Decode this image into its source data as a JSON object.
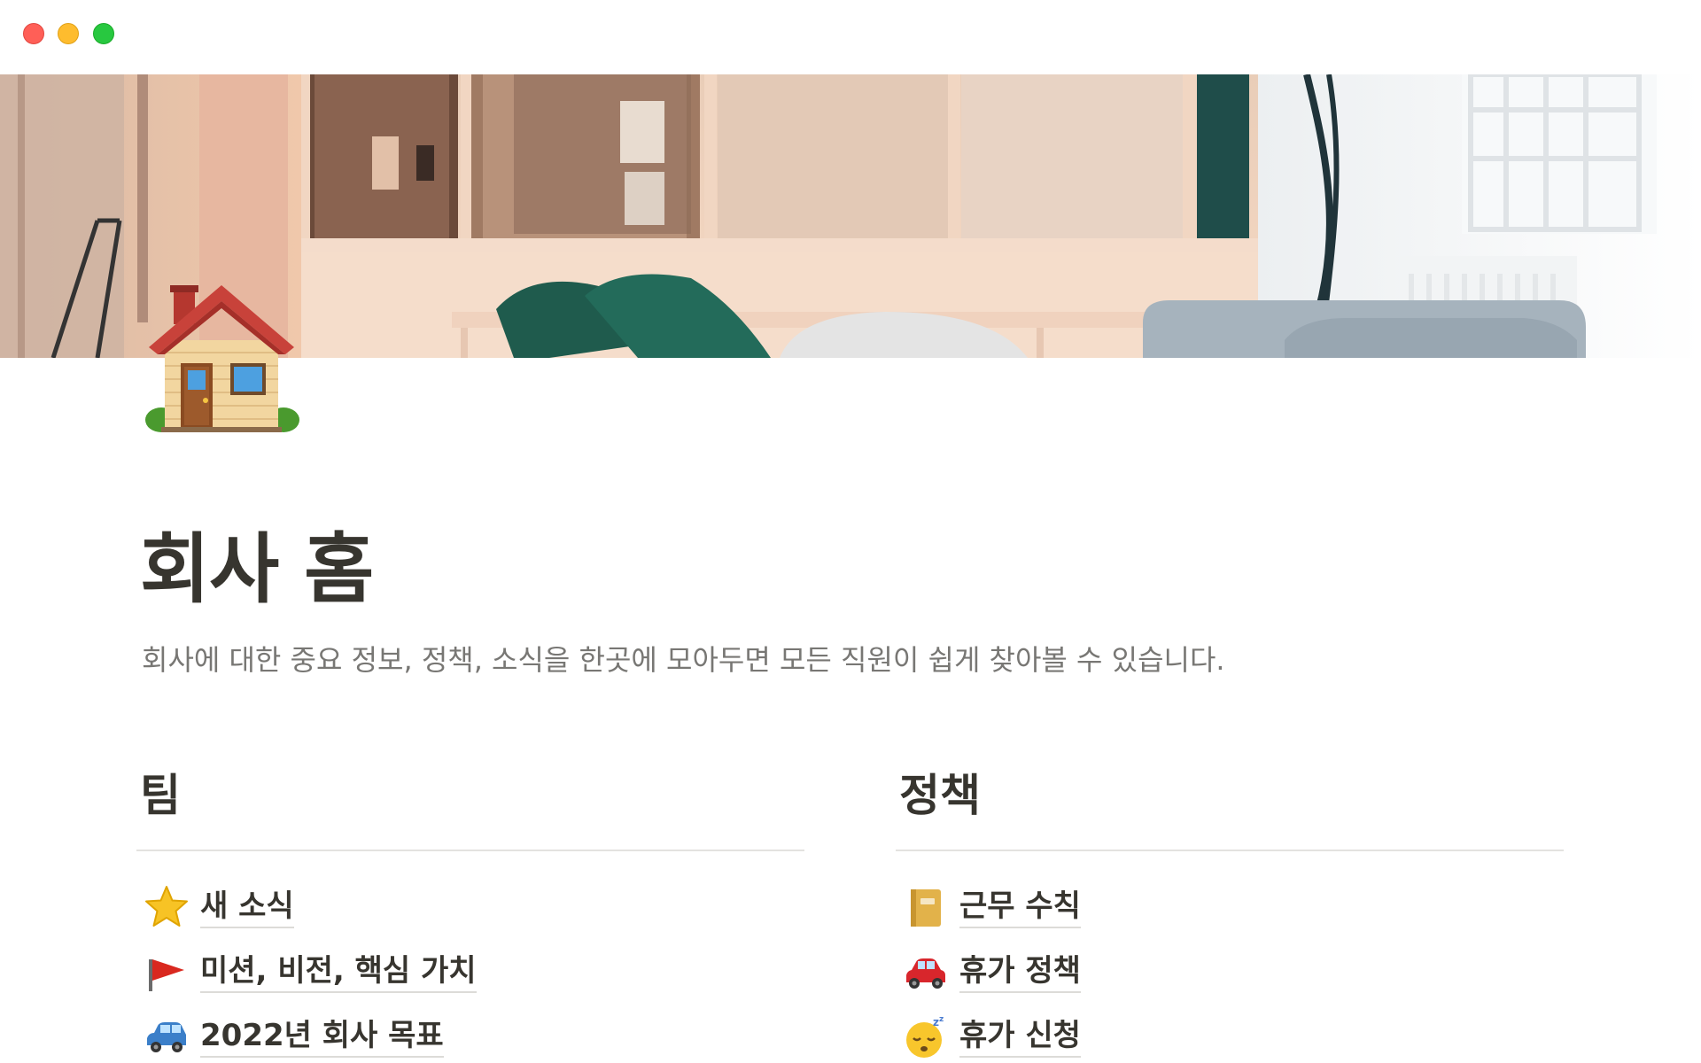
{
  "window": {
    "controls": {
      "close": "close-button",
      "minimize": "minimize-button",
      "zoom": "zoom-button"
    }
  },
  "page": {
    "icon": "house-icon",
    "title": "회사 홈",
    "description": "회사에 대한 중요 정보, 정책, 소식을 한곳에 모아두면 모든 직원이 쉽게 찾아볼 수 있습니다."
  },
  "sections": {
    "team": {
      "heading": "팀",
      "links": [
        {
          "icon": "star-icon",
          "label": "새 소식"
        },
        {
          "icon": "red-flag-icon",
          "label": "미션, 비전, 핵심 가치"
        },
        {
          "icon": "car-icon",
          "label": "2022년 회사 목표"
        }
      ]
    },
    "policy": {
      "heading": "정책",
      "links": [
        {
          "icon": "notebook-icon",
          "label": "근무 수칙"
        },
        {
          "icon": "red-car-icon",
          "label": "휴가 정책"
        },
        {
          "icon": "sleeping-face-icon",
          "label": "휴가 신청"
        }
      ]
    }
  },
  "colors": {
    "text": "#37352f",
    "secondary_text": "#787774",
    "divider": "#e3e2e0",
    "close": "#ff5f57",
    "minimize": "#febc2e",
    "zoom": "#28c840"
  }
}
